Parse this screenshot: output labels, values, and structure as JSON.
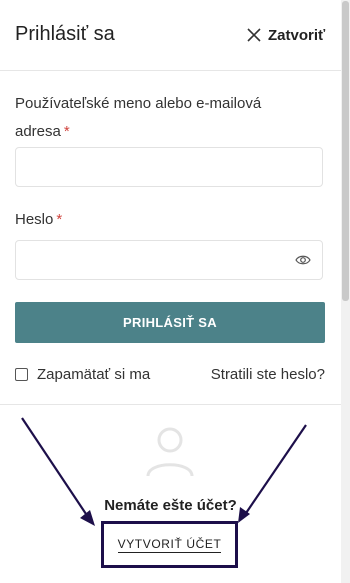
{
  "header": {
    "title": "Prihlásiť sa",
    "close_label": "Zatvoriť"
  },
  "form": {
    "username_label": "Používateľské meno alebo e-mailová adresa",
    "password_label": "Heslo",
    "required_mark": "*",
    "username_value": "",
    "password_value": "",
    "submit_label": "PRIHLÁSIŤ SA",
    "remember_label": "Zapamätať si ma",
    "remember_checked": false,
    "forgot_label": "Stratili ste heslo?"
  },
  "register": {
    "prompt": "Nemáte ešte účet?",
    "create_label": "VYTVORIŤ ÚČET"
  },
  "icons": {
    "close": "close-icon",
    "password_toggle": "eye-icon",
    "avatar": "user-icon"
  },
  "colors": {
    "button": "#4c8289",
    "required": "#d0443e",
    "annotation": "#1d0f4a"
  }
}
